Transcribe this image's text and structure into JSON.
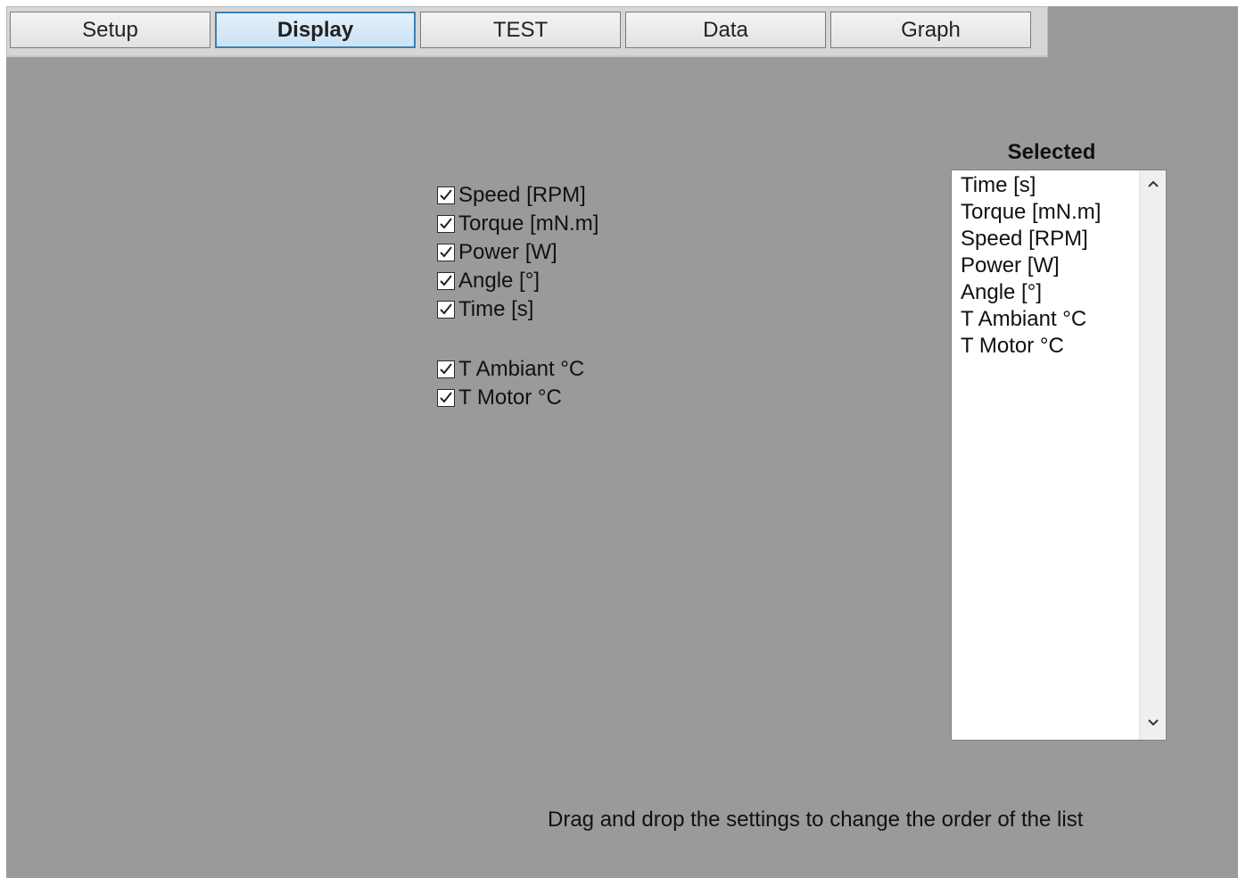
{
  "tabs": [
    {
      "label": "Setup",
      "active": false
    },
    {
      "label": "Display",
      "active": true
    },
    {
      "label": "TEST",
      "active": false
    },
    {
      "label": "Data",
      "active": false
    },
    {
      "label": "Graph",
      "active": false
    }
  ],
  "checkboxes": [
    {
      "label": "Speed [RPM]",
      "checked": true
    },
    {
      "label": "Torque [mN.m]",
      "checked": true
    },
    {
      "label": "Power [W]",
      "checked": true
    },
    {
      "label": "Angle [°]",
      "checked": true
    },
    {
      "label": "Time [s]",
      "checked": true
    },
    {
      "label": "T Ambiant °C",
      "checked": true
    },
    {
      "label": "T Motor °C",
      "checked": true
    }
  ],
  "selected": {
    "title": "Selected",
    "items": [
      "Time [s]",
      "Torque [mN.m]",
      "Speed [RPM]",
      "Power [W]",
      "Angle [°]",
      "T Ambiant °C",
      "T Motor °C"
    ],
    "scroll_up_icon": "chevron-up-icon",
    "scroll_down_icon": "chevron-down-icon"
  },
  "footer": {
    "hint": "Drag and drop the settings to change the order of the list"
  },
  "colors": {
    "background": "#9a9a9a",
    "active_tab_border": "#3c7fb1",
    "active_tab_fill": "#c9e2f6"
  }
}
